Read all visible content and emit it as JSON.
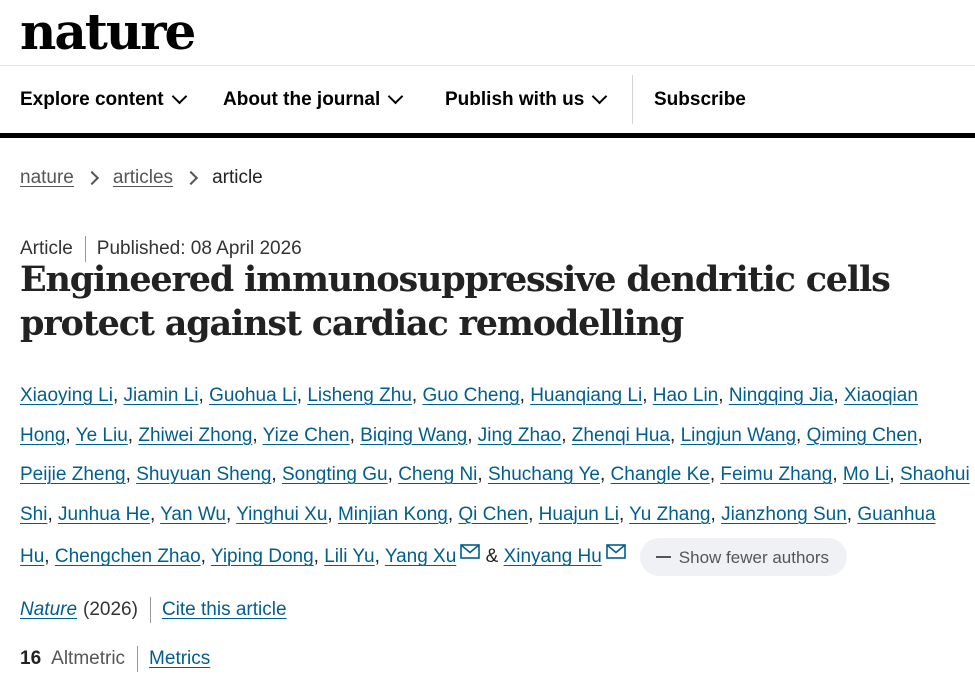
{
  "brand": {
    "logo_text": "nature"
  },
  "nav": {
    "items": [
      {
        "label": "Explore content"
      },
      {
        "label": "About the journal"
      },
      {
        "label": "Publish with us"
      }
    ],
    "subscribe": "Subscribe"
  },
  "breadcrumb": {
    "items": [
      "nature",
      "articles"
    ],
    "current": "article"
  },
  "article": {
    "type": "Article",
    "published": "Published: 08 April 2026",
    "title": "Engineered immunosuppressive dendritic cells protect against cardiac remodelling",
    "authors": [
      "Xiaoying Li",
      "Jiamin Li",
      "Guohua Li",
      "Lisheng Zhu",
      "Guo Cheng",
      "Huanqiang Li",
      "Hao Lin",
      "Ningqing Jia",
      "Xiaoqian Hong",
      "Ye Liu",
      "Zhiwei Zhong",
      "Yize Chen",
      "Biqing Wang",
      "Jing Zhao",
      "Zhenqi Hua",
      "Lingjun Wang",
      "Qiming Chen",
      "Peijie Zheng",
      "Shuyuan Sheng",
      "Songting Gu",
      "Cheng Ni",
      "Shuchang Ye",
      "Changle Ke",
      "Feimu Zhang",
      "Mo Li",
      "Shaohui Shi",
      "Junhua He",
      "Yan Wu",
      "Yinghui Xu",
      "Minjian Kong",
      "Qi Chen",
      "Huajun Li",
      "Yu Zhang",
      "Jianzhong Sun",
      "Guanhua Hu",
      "Chengchen Zhao",
      "Yiping Dong",
      "Lili Yu"
    ],
    "corresponding_authors": [
      "Yang Xu",
      "Xinyang Hu"
    ],
    "and_text": "&",
    "show_fewer": "Show fewer authors",
    "journal": "Nature",
    "year": "(2026)",
    "cite_label": "Cite this article",
    "altmetric_count": "16",
    "altmetric_label": "Altmetric",
    "metrics_label": "Metrics"
  },
  "colors": {
    "link": "#025e8d",
    "text": "#222222",
    "button_bg": "#eff1f4"
  }
}
